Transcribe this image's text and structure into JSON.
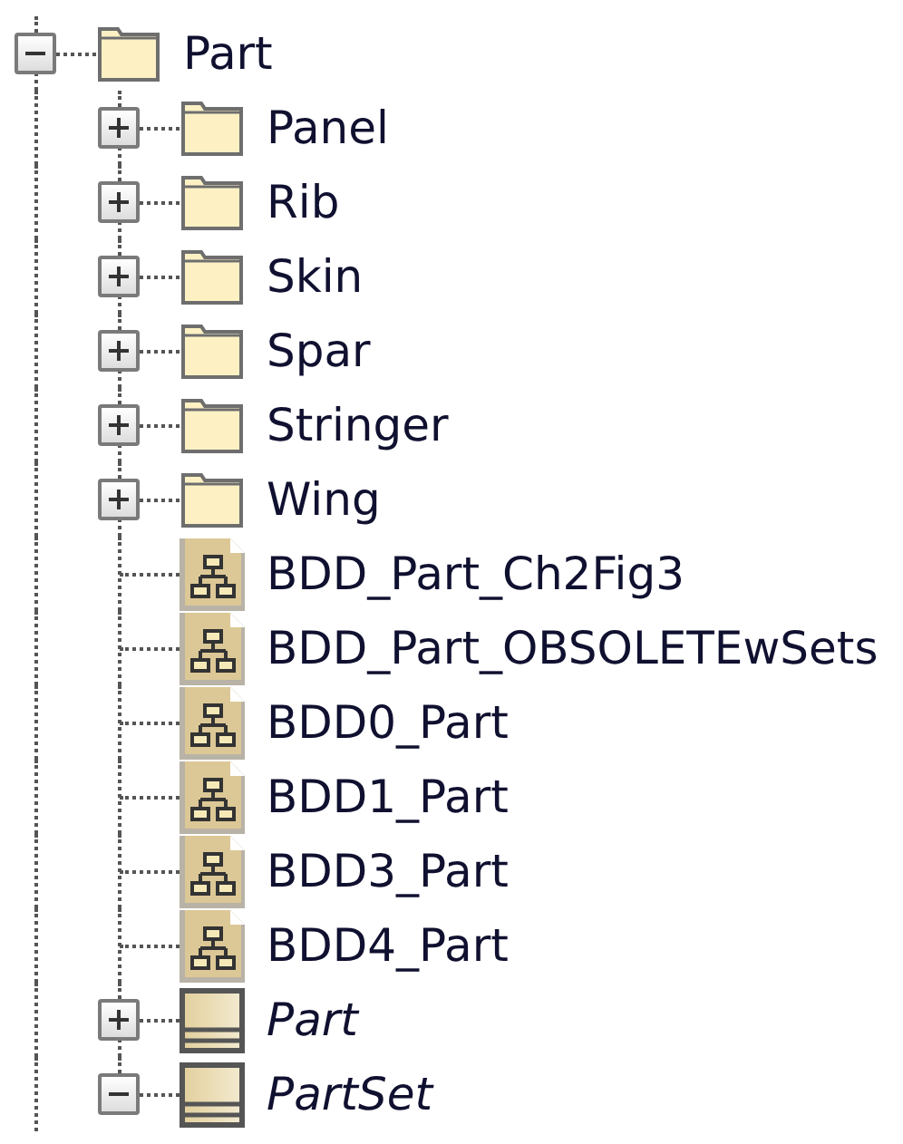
{
  "tree": {
    "label": "Part",
    "kind": "folder",
    "expanded": true,
    "children": [
      {
        "label": "Panel",
        "kind": "folder",
        "expanded": false
      },
      {
        "label": "Rib",
        "kind": "folder",
        "expanded": false
      },
      {
        "label": "Skin",
        "kind": "folder",
        "expanded": false
      },
      {
        "label": "Spar",
        "kind": "folder",
        "expanded": false
      },
      {
        "label": "Stringer",
        "kind": "folder",
        "expanded": false
      },
      {
        "label": "Wing",
        "kind": "folder",
        "expanded": false
      },
      {
        "label": "BDD_Part_Ch2Fig3",
        "kind": "diagram"
      },
      {
        "label": "BDD_Part_OBSOLETEwSets",
        "kind": "diagram"
      },
      {
        "label": "BDD0_Part",
        "kind": "diagram"
      },
      {
        "label": "BDD1_Part",
        "kind": "diagram"
      },
      {
        "label": "BDD3_Part",
        "kind": "diagram"
      },
      {
        "label": "BDD4_Part",
        "kind": "diagram"
      },
      {
        "label": "Part",
        "kind": "block",
        "abstract": true,
        "expanded": false
      },
      {
        "label": "PartSet",
        "kind": "block",
        "abstract": true,
        "expanded": true
      }
    ]
  }
}
